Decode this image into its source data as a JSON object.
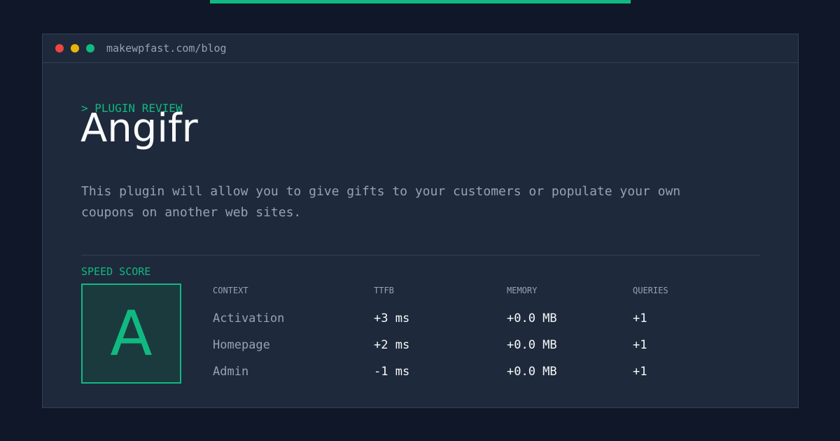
{
  "browser": {
    "url": "makewpfast.com/blog"
  },
  "post": {
    "eyebrow": "> PLUGIN REVIEW",
    "title": "Angifr",
    "description": "This plugin will allow you to give gifts to your customers or populate your own coupons on another web sites."
  },
  "score": {
    "label": "SPEED SCORE",
    "grade": "A"
  },
  "metrics": {
    "headers": {
      "context": "CONTEXT",
      "ttfb": "TTFB",
      "memory": "MEMORY",
      "queries": "QUERIES"
    },
    "rows": [
      {
        "context": "Activation",
        "ttfb": "+3 ms",
        "memory": "+0.0 MB",
        "queries": "+1"
      },
      {
        "context": "Homepage",
        "ttfb": "+2 ms",
        "memory": "+0.0 MB",
        "queries": "+1"
      },
      {
        "context": "Admin",
        "ttfb": "-1 ms",
        "memory": "+0.0 MB",
        "queries": "+1"
      }
    ]
  },
  "colors": {
    "page_background": "#0f1729",
    "card_background": "#1e293b",
    "accent": "#10b981",
    "text_primary": "#f8fafc",
    "text_muted": "#94a3b8",
    "window_close": "#ef4444",
    "window_minimize": "#eab308",
    "window_maximize": "#10b981"
  }
}
